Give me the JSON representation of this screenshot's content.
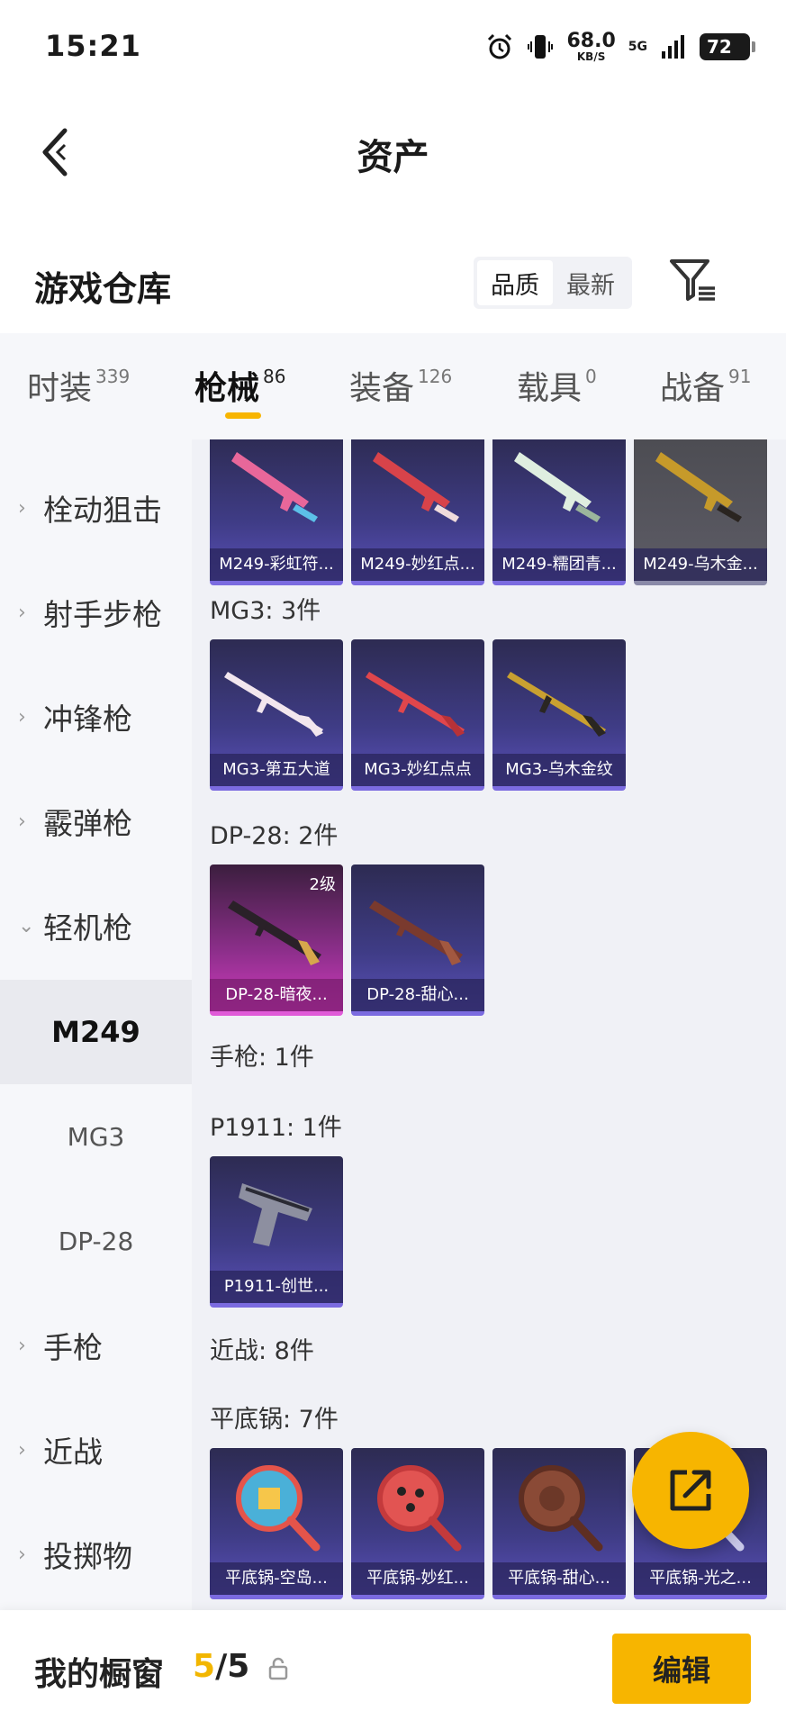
{
  "status_bar": {
    "time": "15:21",
    "speed_value": "68.0",
    "speed_unit": "KB/S",
    "network": "5G",
    "battery": "72"
  },
  "header": {
    "title": "资产",
    "back_icon": "chevron-left-icon"
  },
  "warehouse": {
    "title": "游戏仓库",
    "sort_options": [
      "品质",
      "最新"
    ],
    "sort_active": "品质",
    "filter_icon": "filter-icon"
  },
  "tabs": [
    {
      "label": "时装",
      "count": "339",
      "active": false
    },
    {
      "label": "枪械",
      "count": "86",
      "active": true
    },
    {
      "label": "装备",
      "count": "126",
      "active": false
    },
    {
      "label": "载具",
      "count": "0",
      "active": false
    },
    {
      "label": "战备",
      "count": "91",
      "active": false
    }
  ],
  "sidenav": {
    "items": [
      {
        "label": "栓动狙击",
        "expanded": false
      },
      {
        "label": "射手步枪",
        "expanded": false
      },
      {
        "label": "冲锋枪",
        "expanded": false
      },
      {
        "label": "霰弹枪",
        "expanded": false
      },
      {
        "label": "轻机枪",
        "expanded": true
      }
    ],
    "subitems": [
      {
        "label": "M249",
        "active": true
      },
      {
        "label": "MG3",
        "active": false
      },
      {
        "label": "DP-28",
        "active": false
      }
    ],
    "items_after": [
      {
        "label": "手枪",
        "expanded": false
      },
      {
        "label": "近战",
        "expanded": false
      },
      {
        "label": "投掷物",
        "expanded": false
      }
    ]
  },
  "content": {
    "m249_cards": [
      "M249-彩虹符...",
      "M249-妙红点...",
      "M249-糯团青...",
      "M249-乌木金..."
    ],
    "groups": [
      {
        "label": "MG3: 3件",
        "cards": [
          "MG3-第五大道",
          "MG3-妙红点点",
          "MG3-乌木金纹"
        ]
      },
      {
        "label": "DP-28: 2件",
        "cards": [
          "DP-28-暗夜...",
          "DP-28-甜心..."
        ],
        "level_badge": "2级"
      },
      {
        "label": "手枪: 1件"
      },
      {
        "label": "P1911: 1件",
        "cards": [
          "P1911-创世..."
        ]
      },
      {
        "label": "近战: 8件"
      },
      {
        "label": "平底锅: 7件",
        "cards": [
          "平底锅-空岛...",
          "平底锅-妙红...",
          "平底锅-甜心...",
          "平底锅-光之..."
        ]
      }
    ]
  },
  "fab": {
    "icon": "share-external-icon"
  },
  "bottom_bar": {
    "label": "我的橱窗",
    "current": "5",
    "separator": "/",
    "total": "5",
    "lock_icon": "lock-icon",
    "edit_label": "编辑"
  },
  "colors": {
    "accent": "#f7b500",
    "card_purple": "#3f3c86",
    "card_pink": "#d03bbd"
  }
}
